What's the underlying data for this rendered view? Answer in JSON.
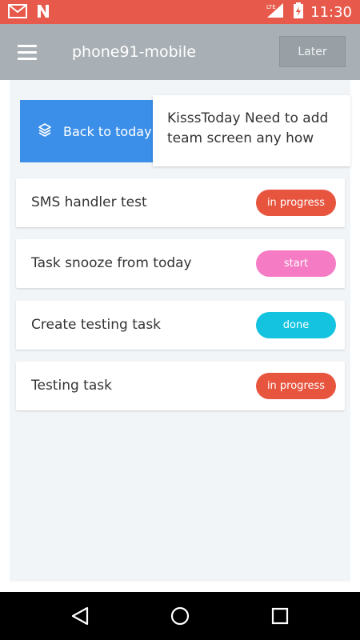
{
  "status_bar": {
    "time": "11:30",
    "network_label": "LTE",
    "icons": [
      "gmail-icon",
      "notification-n-icon",
      "signal-icon",
      "battery-icon"
    ]
  },
  "app_bar": {
    "title": "phone91-mobile",
    "later_label": "Later",
    "menu_icon": "hamburger-menu-icon"
  },
  "back_button": {
    "label": "Back to today",
    "icon": "layers-icon"
  },
  "notice": {
    "text": "KisssToday Need to add team screen any how"
  },
  "tasks": [
    {
      "title": "SMS handler test",
      "status": "in progress",
      "status_color": "#e8553f"
    },
    {
      "title": "Task snooze from today",
      "status": "start",
      "status_color": "#f57bc4"
    },
    {
      "title": "Create testing task",
      "status": "done",
      "status_color": "#13c3e0"
    },
    {
      "title": "Testing task",
      "status": "in progress",
      "status_color": "#e8553f"
    }
  ],
  "nav_bar": {
    "icons": [
      "back-triangle-icon",
      "home-circle-icon",
      "recents-square-icon"
    ]
  },
  "colors": {
    "status_bar": "#e75a4b",
    "app_bar": "#a9b0b5",
    "accent_blue": "#3b8fe9",
    "content_bg": "#f2f5f8"
  }
}
